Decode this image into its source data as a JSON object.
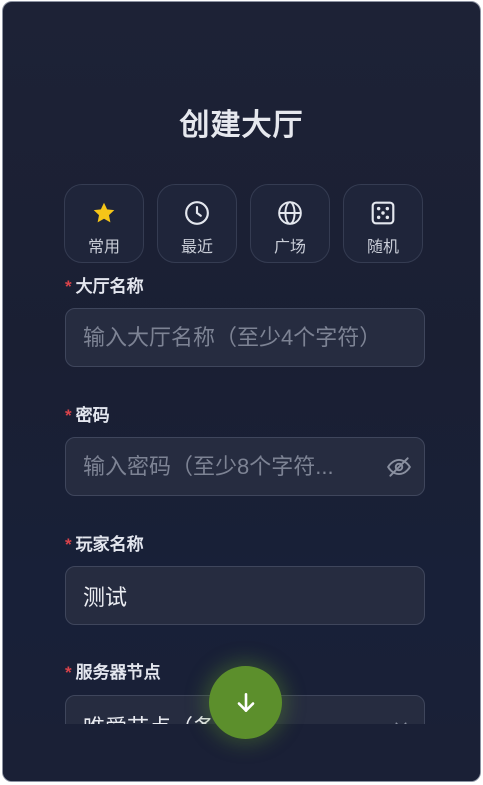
{
  "title": "创建大厅",
  "quick_options": [
    {
      "label": "常用",
      "icon": "star-icon"
    },
    {
      "label": "最近",
      "icon": "clock-icon"
    },
    {
      "label": "广场",
      "icon": "globe-icon"
    },
    {
      "label": "随机",
      "icon": "dice-icon"
    }
  ],
  "required_mark": "*",
  "form": {
    "lobby_name": {
      "label": "大厅名称",
      "placeholder": "输入大厅名称（至少4个字符）",
      "value": ""
    },
    "password": {
      "label": "密码",
      "placeholder": "输入密码（至少8个字符...",
      "value": ""
    },
    "player_name": {
      "label": "玩家名称",
      "placeholder": "",
      "value": "测试"
    },
    "server_node": {
      "label": "服务器节点",
      "value": "唯爱节点（备..."
    }
  },
  "colors": {
    "accent": "#5c8f2c",
    "required": "#d9434a",
    "star": "#f5c518"
  }
}
